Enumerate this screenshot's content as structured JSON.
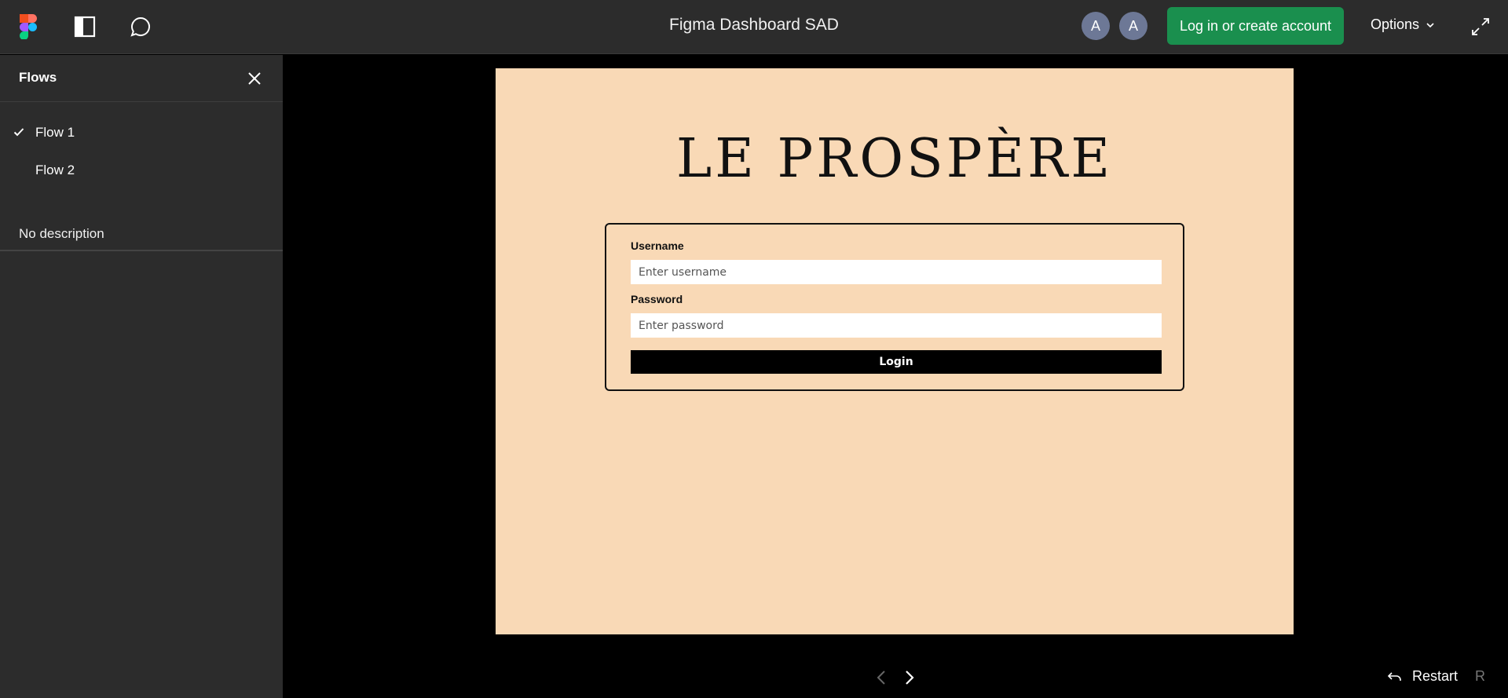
{
  "header": {
    "title": "Figma Dashboard SAD",
    "avatars": [
      "A",
      "A"
    ],
    "login_label": "Log in or create account",
    "options_label": "Options",
    "icons": [
      "figma-logo-icon",
      "sidebar-toggle-icon",
      "comment-icon",
      "chevron-down-icon",
      "fullscreen-icon"
    ]
  },
  "sidebar": {
    "title": "Flows",
    "flows": [
      {
        "label": "Flow 1",
        "selected": true
      },
      {
        "label": "Flow 2",
        "selected": false
      }
    ],
    "description": "No description"
  },
  "frame": {
    "brand": "LE PROSPÈRE",
    "username_label": "Username",
    "username_placeholder": "Enter username",
    "password_label": "Password",
    "password_placeholder": "Enter password",
    "login_button": "Login"
  },
  "footer": {
    "restart_label": "Restart",
    "restart_key": "R"
  },
  "colors": {
    "topbar_bg": "#2c2c2c",
    "login_button_bg": "#1a8f4e",
    "avatar_bg": "#6d7896",
    "frame_bg": "#f9d9b6",
    "canvas_bg": "#000000"
  }
}
